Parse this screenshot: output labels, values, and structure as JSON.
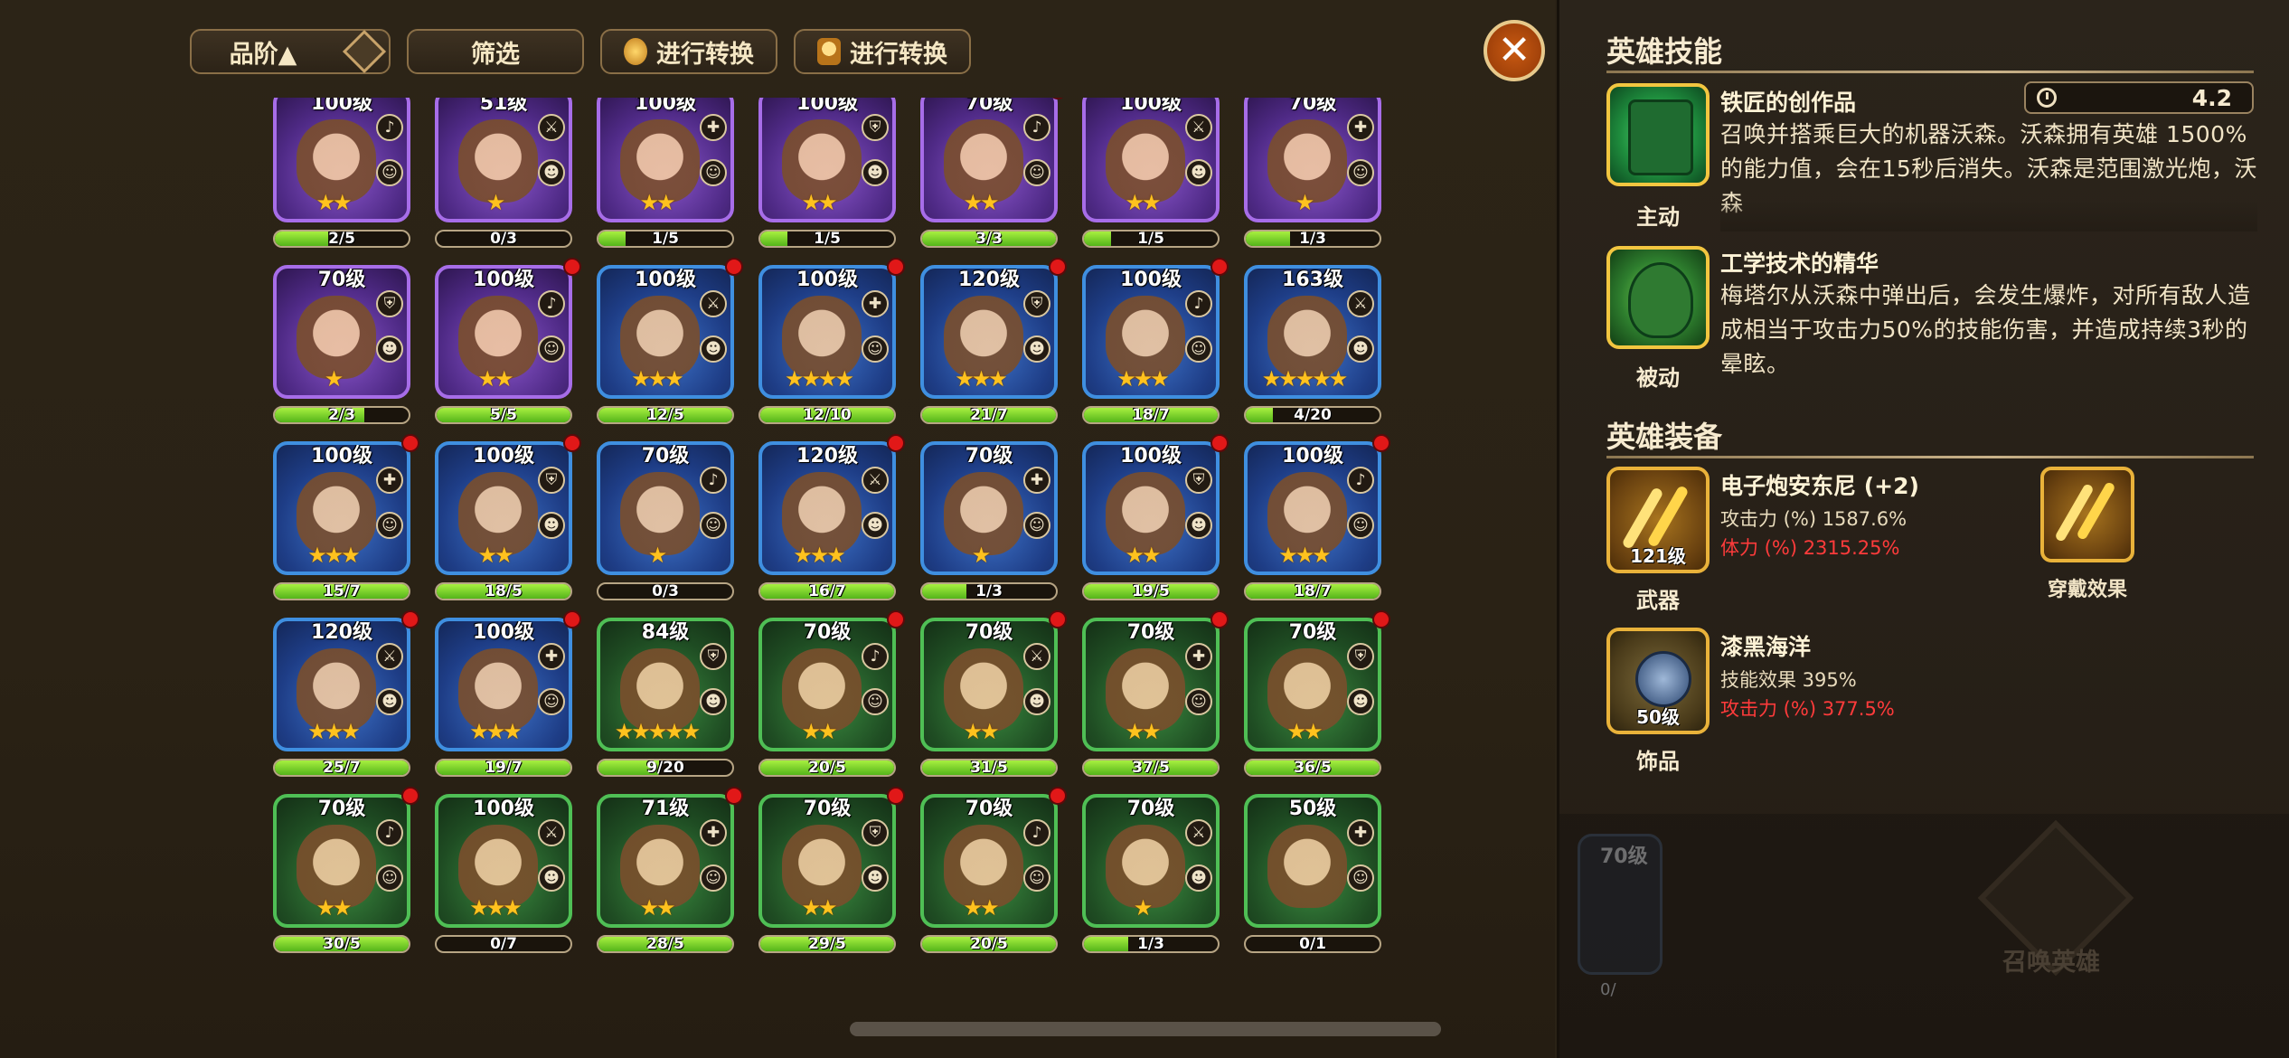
{
  "toolbar": {
    "grade_label": "品阶▲",
    "filter_label": "筛选",
    "convert_label_1": "进行转换",
    "convert_label_2": "进行转换"
  },
  "heroes": [
    {
      "level": "100级",
      "rarity": "purple",
      "stars": "★★",
      "progress": "2/5",
      "fill": 0.4,
      "dot": false
    },
    {
      "level": "51级",
      "rarity": "purple",
      "stars": "★",
      "progress": "0/3",
      "fill": 0,
      "dot": false
    },
    {
      "level": "100级",
      "rarity": "purple",
      "stars": "★★",
      "progress": "1/5",
      "fill": 0.2,
      "dot": false
    },
    {
      "level": "100级",
      "rarity": "purple",
      "stars": "★★",
      "progress": "1/5",
      "fill": 0.2,
      "dot": false
    },
    {
      "level": "70级",
      "rarity": "purple",
      "stars": "★★",
      "progress": "3/3",
      "fill": 1,
      "dot": true
    },
    {
      "level": "100级",
      "rarity": "purple",
      "stars": "★★",
      "progress": "1/5",
      "fill": 0.2,
      "dot": false
    },
    {
      "level": "70级",
      "rarity": "purple",
      "stars": "★",
      "progress": "1/3",
      "fill": 0.33,
      "dot": false
    },
    {
      "level": "70级",
      "rarity": "purple",
      "stars": "★",
      "progress": "2/3",
      "fill": 0.67,
      "dot": false
    },
    {
      "level": "100级",
      "rarity": "purple",
      "stars": "★★",
      "progress": "5/5",
      "fill": 1,
      "dot": true
    },
    {
      "level": "100级",
      "rarity": "blue",
      "stars": "★★★",
      "progress": "12/5",
      "fill": 1,
      "dot": true
    },
    {
      "level": "100级",
      "rarity": "blue",
      "stars": "★★★★",
      "progress": "12/10",
      "fill": 1,
      "dot": true
    },
    {
      "level": "120级",
      "rarity": "blue",
      "stars": "★★★",
      "progress": "21/7",
      "fill": 1,
      "dot": true
    },
    {
      "level": "100级",
      "rarity": "blue",
      "stars": "★★★",
      "progress": "18/7",
      "fill": 1,
      "dot": true
    },
    {
      "level": "163级",
      "rarity": "blue",
      "stars": "★★★★★",
      "progress": "4/20",
      "fill": 0.2,
      "dot": false
    },
    {
      "level": "100级",
      "rarity": "blue",
      "stars": "★★★",
      "progress": "15/7",
      "fill": 1,
      "dot": true
    },
    {
      "level": "100级",
      "rarity": "blue",
      "stars": "★★",
      "progress": "18/5",
      "fill": 1,
      "dot": true
    },
    {
      "level": "70级",
      "rarity": "blue",
      "stars": "★",
      "progress": "0/3",
      "fill": 0,
      "dot": false
    },
    {
      "level": "120级",
      "rarity": "blue",
      "stars": "★★★",
      "progress": "16/7",
      "fill": 1,
      "dot": true
    },
    {
      "level": "70级",
      "rarity": "blue",
      "stars": "★",
      "progress": "1/3",
      "fill": 0.33,
      "dot": false
    },
    {
      "level": "100级",
      "rarity": "blue",
      "stars": "★★",
      "progress": "19/5",
      "fill": 1,
      "dot": true
    },
    {
      "level": "100级",
      "rarity": "blue",
      "stars": "★★★",
      "progress": "18/7",
      "fill": 1,
      "dot": true
    },
    {
      "level": "120级",
      "rarity": "blue",
      "stars": "★★★",
      "progress": "25/7",
      "fill": 1,
      "dot": true
    },
    {
      "level": "100级",
      "rarity": "blue",
      "stars": "★★★",
      "progress": "19/7",
      "fill": 1,
      "dot": true
    },
    {
      "level": "84级",
      "rarity": "green",
      "stars": "★★★★★",
      "progress": "9/20",
      "fill": 0.45,
      "dot": false
    },
    {
      "level": "70级",
      "rarity": "green",
      "stars": "★★",
      "progress": "20/5",
      "fill": 1,
      "dot": true
    },
    {
      "level": "70级",
      "rarity": "green",
      "stars": "★★",
      "progress": "31/5",
      "fill": 1,
      "dot": true
    },
    {
      "level": "70级",
      "rarity": "green",
      "stars": "★★",
      "progress": "37/5",
      "fill": 1,
      "dot": true
    },
    {
      "level": "70级",
      "rarity": "green",
      "stars": "★★",
      "progress": "36/5",
      "fill": 1,
      "dot": true
    },
    {
      "level": "70级",
      "rarity": "green",
      "stars": "★★",
      "progress": "30/5",
      "fill": 1,
      "dot": true
    },
    {
      "level": "100级",
      "rarity": "green",
      "stars": "★★★",
      "progress": "0/7",
      "fill": 0,
      "dot": false
    },
    {
      "level": "71级",
      "rarity": "green",
      "stars": "★★",
      "progress": "28/5",
      "fill": 1,
      "dot": true
    },
    {
      "level": "70级",
      "rarity": "green",
      "stars": "★★",
      "progress": "29/5",
      "fill": 1,
      "dot": true
    },
    {
      "level": "70级",
      "rarity": "green",
      "stars": "★★",
      "progress": "20/5",
      "fill": 1,
      "dot": true
    },
    {
      "level": "70级",
      "rarity": "green",
      "stars": "★",
      "progress": "1/3",
      "fill": 0.33,
      "dot": false
    },
    {
      "level": "50级",
      "rarity": "green",
      "stars": "",
      "progress": "0/1",
      "fill": 0,
      "dot": false
    }
  ],
  "skills": {
    "title": "英雄技能",
    "active": {
      "name": "铁匠的创作品",
      "cooldown": "4.2",
      "tag": "主动",
      "desc": "召唤并搭乘巨大的机器沃森。沃森拥有英雄 1500%的能力值，会在15秒后消失。沃森是范围激光炮，沃森"
    },
    "passive": {
      "name": "工学技术的精华",
      "tag": "被动",
      "desc": "梅塔尔从沃森中弹出后，会发生爆炸，对所有敌人造成相当于攻击力50%的技能伤害，并造成持续3秒的晕眩。"
    }
  },
  "equipment": {
    "title": "英雄装备",
    "weapon": {
      "name": "电子炮安东尼 (+2)",
      "level": "121级",
      "tag": "武器",
      "stat1": "攻击力 (%) 1587.6%",
      "stat2": "体力 (%) 2315.25%"
    },
    "accessory": {
      "name": "漆黑海洋",
      "level": "50级",
      "tag": "饰品",
      "stat1": "技能效果 395%",
      "stat2": "攻击力 (%) 377.5%"
    },
    "wear_label": "穿戴效果"
  },
  "background": {
    "ghost_level": "70级",
    "ghost_progress": "0/",
    "summon_label": "召唤英雄"
  },
  "colors": {
    "purple_frame": "#a76de8",
    "blue_frame": "#3f8fe0",
    "green_frame": "#4fbf55",
    "progress_fill": "#7bd72e",
    "alert_dot": "#e11818",
    "stat_red": "#ff3b3b"
  }
}
